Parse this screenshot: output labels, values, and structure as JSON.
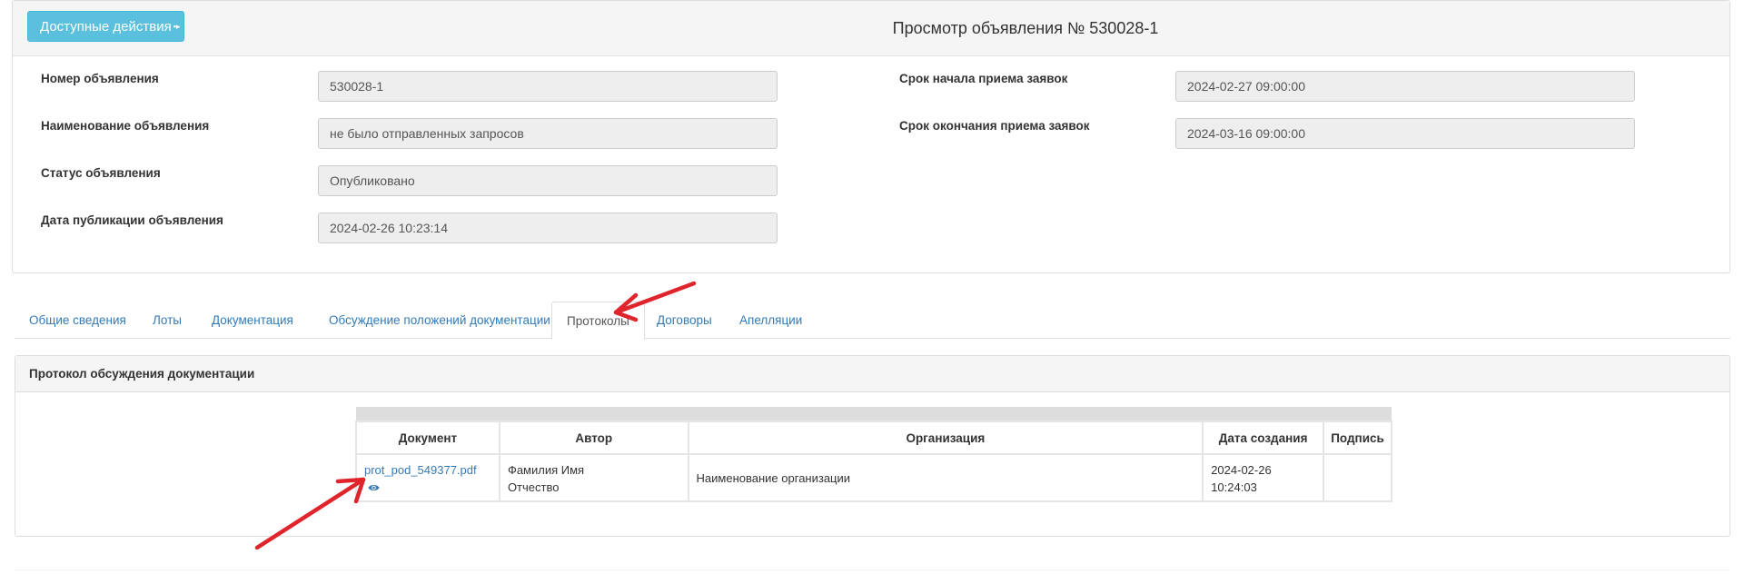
{
  "header": {
    "actions_button": "Доступные действия",
    "title": "Просмотр объявления № 530028-1"
  },
  "fields_left": [
    {
      "label": "Номер объявления",
      "value": "530028-1"
    },
    {
      "label": "Наименование объявления",
      "value": "не было отправленных запросов"
    },
    {
      "label": "Статус объявления",
      "value": "Опубликовано"
    },
    {
      "label": "Дата публикации объявления",
      "value": "2024-02-26 10:23:14"
    }
  ],
  "fields_right": [
    {
      "label": "Срок начала приема заявок",
      "value": "2024-02-27 09:00:00"
    },
    {
      "label": "Срок окончания приема заявок",
      "value": "2024-03-16 09:00:00"
    }
  ],
  "tabs": [
    {
      "label": "Общие сведения"
    },
    {
      "label": "Лоты"
    },
    {
      "label": "Документация"
    },
    {
      "label": "Обсуждение положений документации"
    },
    {
      "label": "Протоколы"
    },
    {
      "label": "Договоры"
    },
    {
      "label": "Апелляции"
    }
  ],
  "active_tab": "Протоколы",
  "protocol_panel": {
    "title": "Протокол обсуждения документации",
    "columns": [
      "Документ",
      "Автор",
      "Организация",
      "Дата создания",
      "Подпись"
    ],
    "rows": [
      {
        "document": "prot_pod_549377.pdf",
        "author_line1": "Фамилия Имя",
        "author_line2": "Отчество",
        "organization": "Наименование организации",
        "date_line1": "2024-02-26",
        "date_line2": "10:24:03",
        "signature": ""
      }
    ]
  },
  "colors": {
    "accent_button": "#5bc0de",
    "link": "#337ab7",
    "annotation_arrow": "#e0242c"
  }
}
